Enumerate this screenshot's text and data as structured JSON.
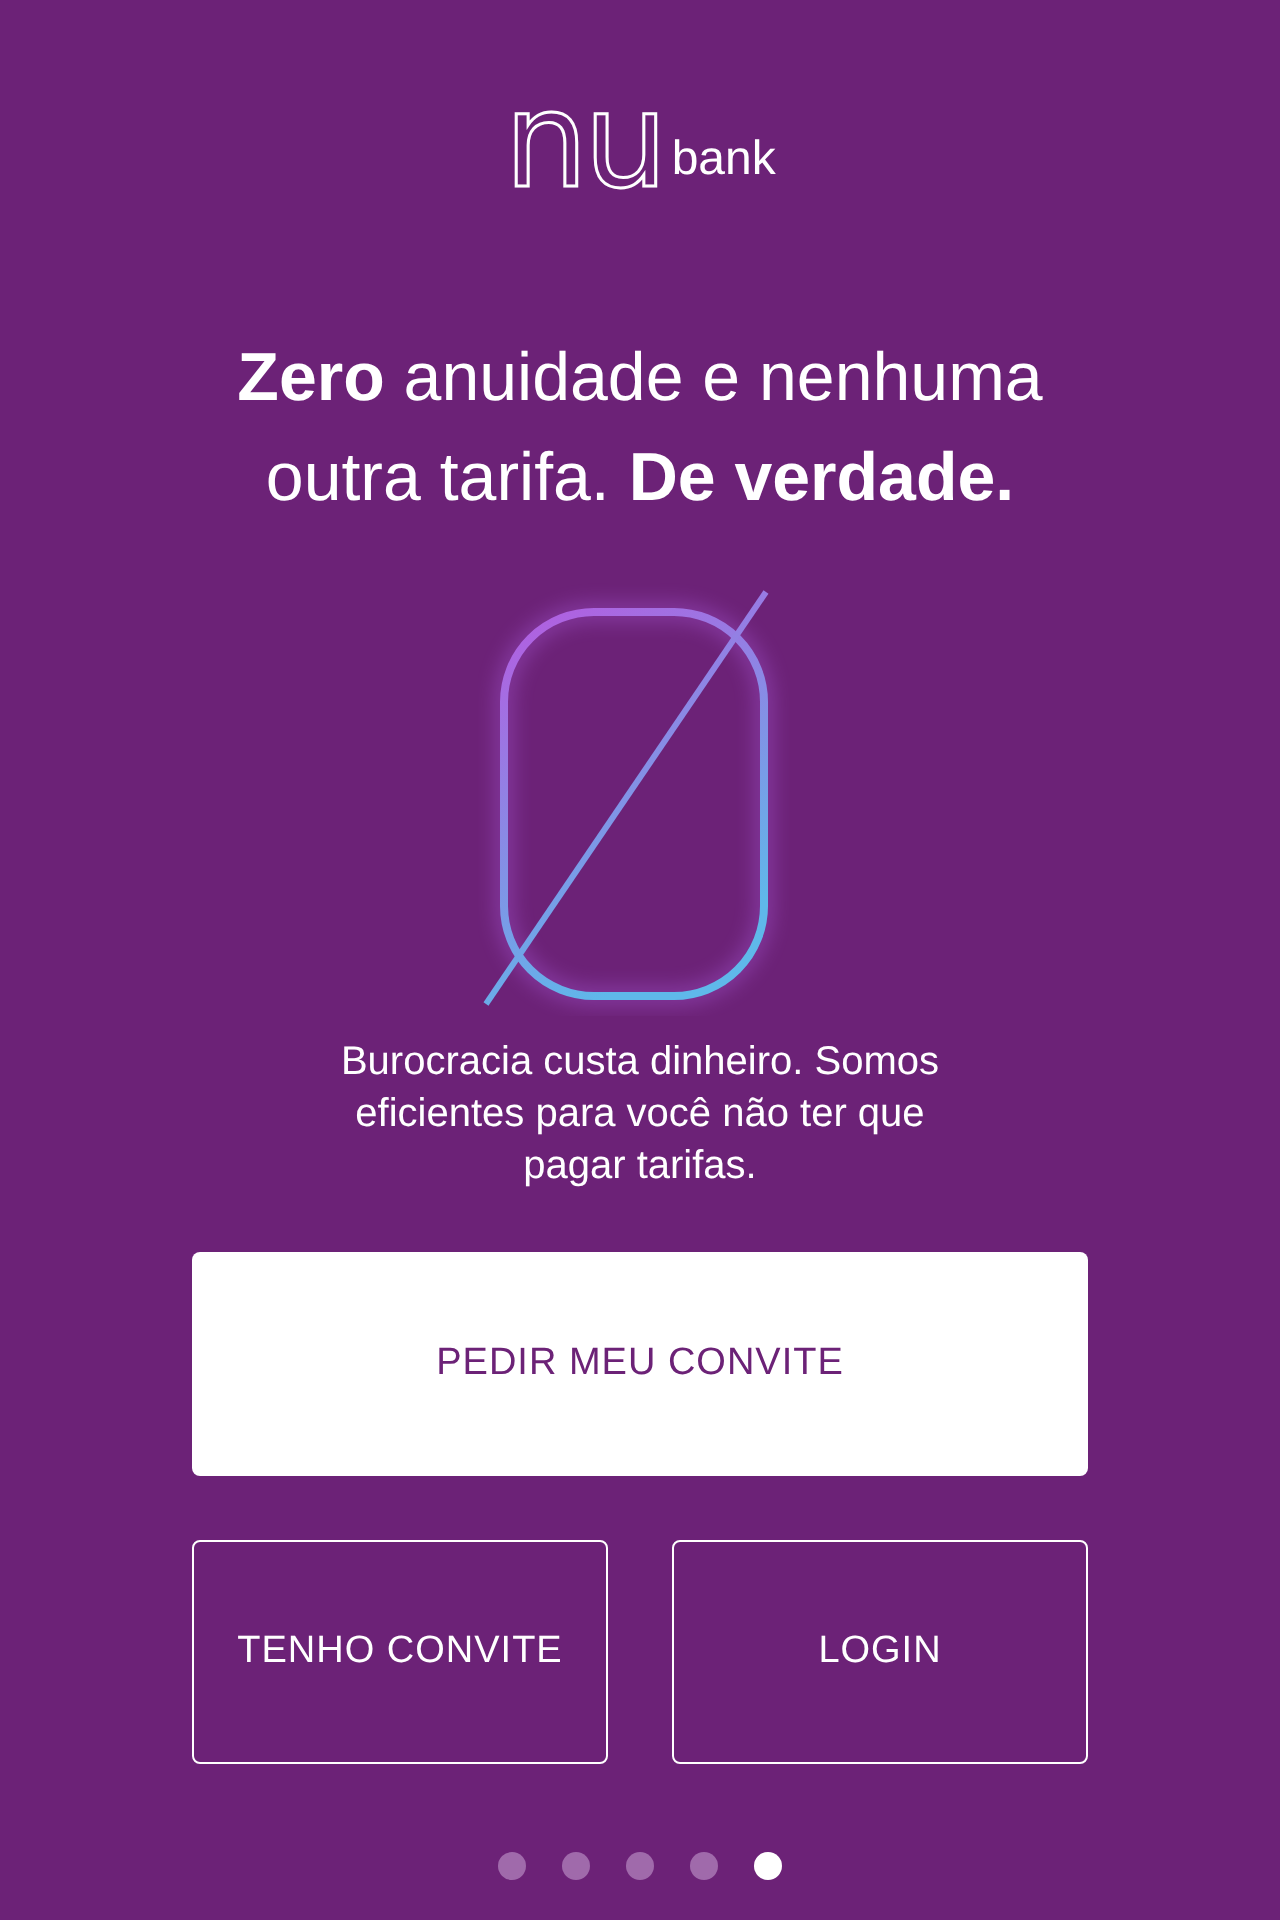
{
  "logo": {
    "mark": "nu",
    "word": "bank"
  },
  "headline": "**Zero** anuidade e nenhuma outra tarifa. **De verdade.**",
  "description": "Burocracia custa dinheiro. Somos eficientes para você não ter que pagar tarifas.",
  "buttons": [
    {
      "label": "PEDIR MEU CONVITE",
      "kind": "primary"
    },
    {
      "label": "TENHO CONVITE",
      "kind": "outline"
    },
    {
      "label": "LOGIN",
      "kind": "outline"
    }
  ],
  "pages": [
    {
      "selected": false
    },
    {
      "selected": false
    },
    {
      "selected": false
    },
    {
      "selected": false
    },
    {
      "selected": true
    }
  ]
}
